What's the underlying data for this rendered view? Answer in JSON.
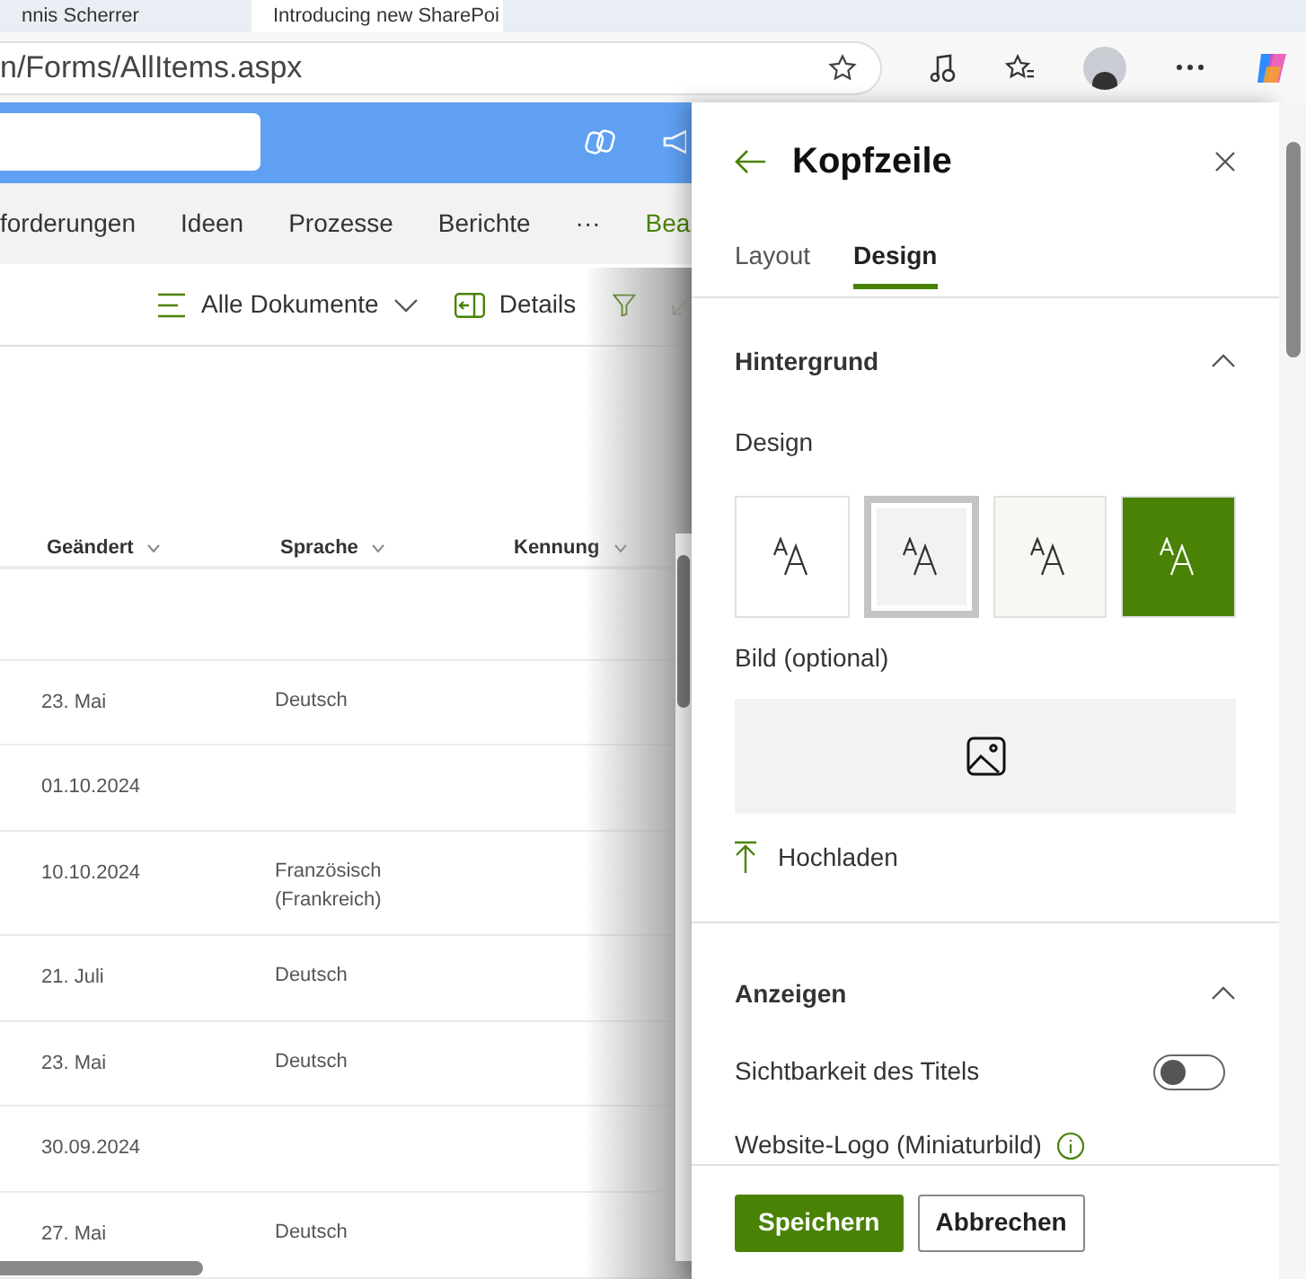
{
  "browser": {
    "tabs": [
      {
        "title": "nnis Scherrer",
        "selected": false
      },
      {
        "title": "Introducing new SharePoi",
        "selected": true
      }
    ],
    "address": "n/Forms/AllItems.aspx"
  },
  "nav": {
    "items": [
      "forderungen",
      "Ideen",
      "Prozesse",
      "Berichte",
      "···",
      "Bea"
    ]
  },
  "commands": {
    "view": "Alle Dokumente",
    "details": "Details"
  },
  "table": {
    "columns": [
      "Geändert",
      "Sprache",
      "Kennung"
    ],
    "rows": [
      {
        "changed": "23. Mai",
        "language": "Deutsch"
      },
      {
        "changed": "01.10.2024",
        "language": ""
      },
      {
        "changed": "10.10.2024",
        "language": "Französisch (Frankreich)"
      },
      {
        "changed": "21. Juli",
        "language": "Deutsch"
      },
      {
        "changed": "23. Mai",
        "language": "Deutsch"
      },
      {
        "changed": "30.09.2024",
        "language": ""
      },
      {
        "changed": "27. Mai",
        "language": "Deutsch"
      }
    ]
  },
  "panel": {
    "title": "Kopfzeile",
    "tabs": [
      {
        "label": "Layout",
        "selected": false
      },
      {
        "label": "Design",
        "selected": true
      }
    ],
    "background_section": {
      "title": "Hintergrund",
      "expanded": true,
      "design_label": "Design",
      "designs": [
        {
          "kind": "white",
          "selected": false
        },
        {
          "kind": "neutral",
          "selected": true
        },
        {
          "kind": "soft",
          "selected": false
        },
        {
          "kind": "strong",
          "selected": false
        }
      ],
      "image_label": "Bild (optional)",
      "upload": "Hochladen"
    },
    "display_section": {
      "title": "Anzeigen",
      "expanded": true,
      "title_visibility": {
        "label": "Sichtbarkeit des Titels",
        "on": false
      },
      "logo_label": "Website-Logo (Miniaturbild)"
    },
    "buttons": {
      "save": "Speichern",
      "cancel": "Abbrechen"
    }
  }
}
